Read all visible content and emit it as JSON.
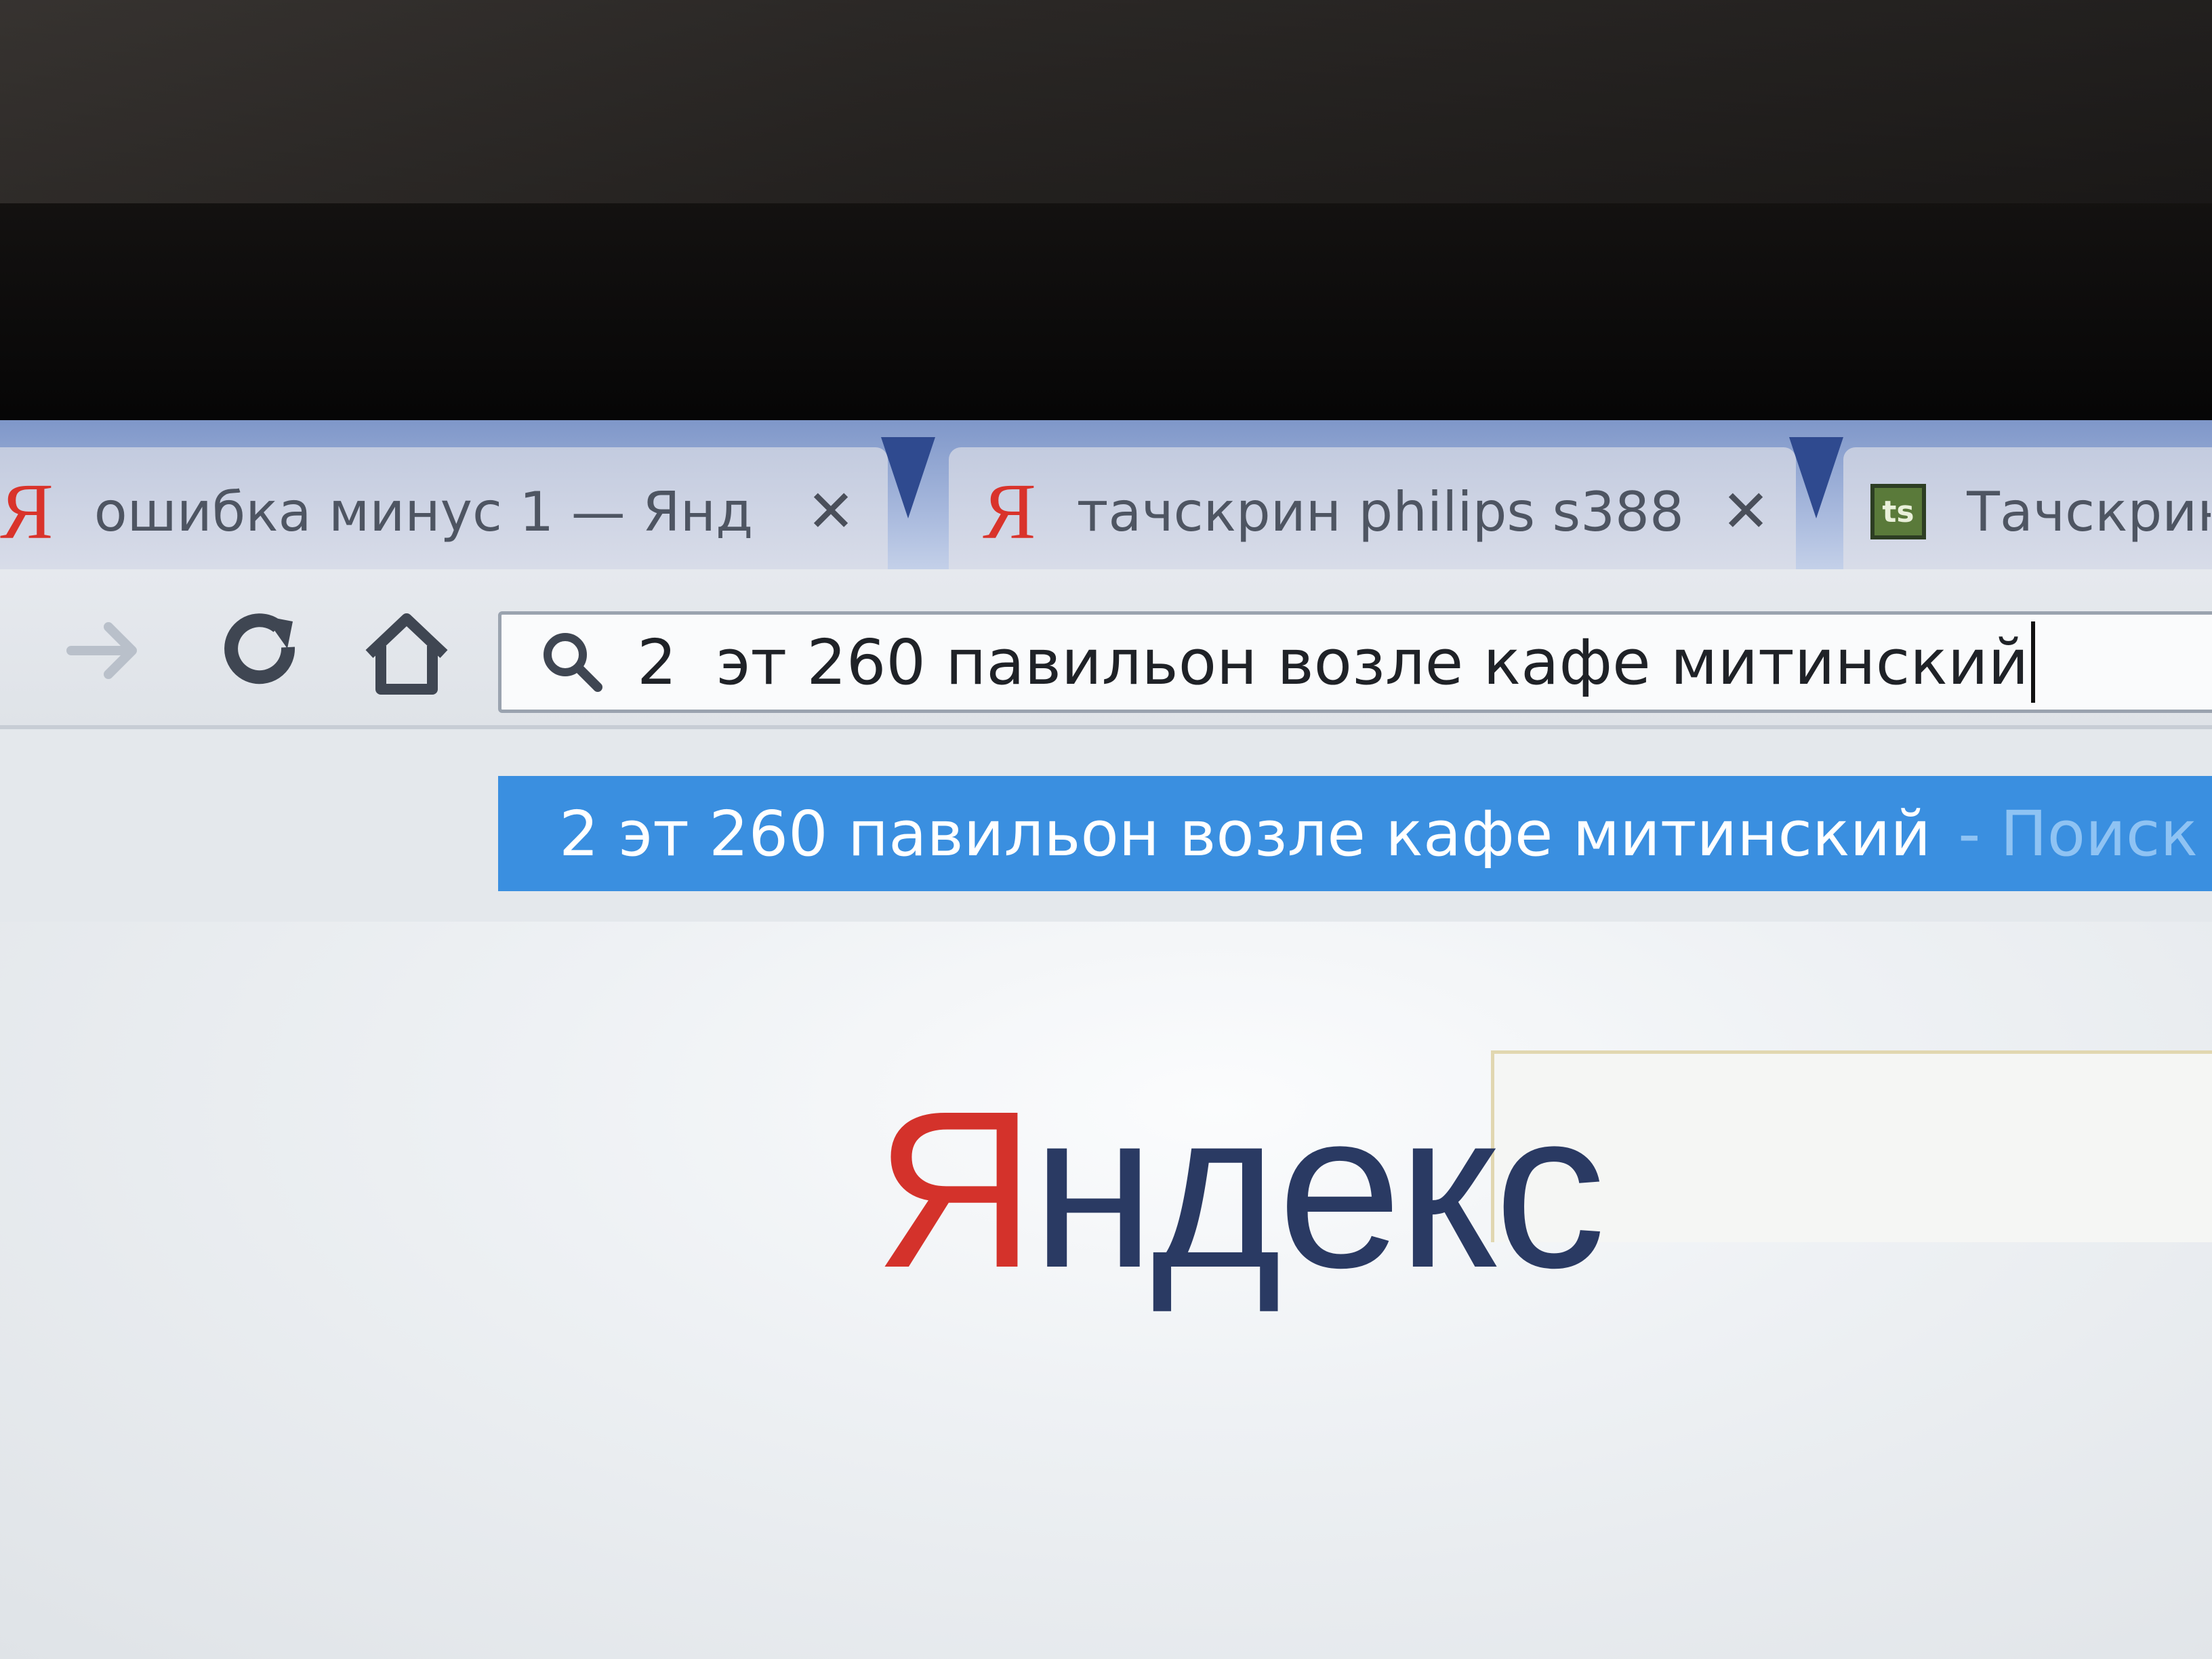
{
  "tabs": [
    {
      "favicon": "yandex-favicon",
      "favicon_text": "Я",
      "title": "ошибка минус 1 — Янд",
      "close": "✕"
    },
    {
      "favicon": "yandex-favicon",
      "favicon_text": "Я",
      "title": "тачскрин philips s388 —",
      "close": "✕"
    },
    {
      "favicon": "site-favicon",
      "favicon_text": "ts",
      "title": "Тачскрин P"
    }
  ],
  "omnibox": {
    "value": "2  эт 260 павильон возле кафе митинский"
  },
  "suggestion": {
    "text": "2 эт 260 павильон возле кафе митинский",
    "hint": "- Поиск Янд"
  },
  "logo": {
    "first": "Я",
    "rest": "ндекс"
  },
  "colors": {
    "tabstrip": "#8ea4d3",
    "suggestion_highlight": "#3a8fe0",
    "yandex_red": "#d4322b",
    "yandex_dark": "#2a3a63"
  }
}
